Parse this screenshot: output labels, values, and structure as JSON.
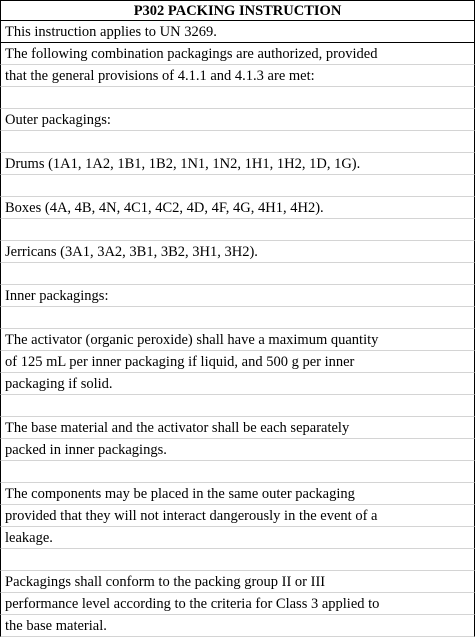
{
  "title": "P302 PACKING INSTRUCTION",
  "rows": [
    "This instruction applies to UN 3269.",
    "The following combination packagings are authorized, provided",
    "that the general provisions of 4.1.1 and 4.1.3 are met:",
    "",
    "Outer packagings:",
    "",
    "Drums (1A1, 1A2, 1B1, 1B2, 1N1, 1N2, 1H1, 1H2, 1D, 1G).",
    "",
    "Boxes (4A, 4B, 4N, 4C1, 4C2, 4D, 4F, 4G, 4H1, 4H2).",
    "",
    "Jerricans (3A1, 3A2, 3B1, 3B2, 3H1, 3H2).",
    "",
    "Inner packagings:",
    "",
    "The activator (organic peroxide) shall have a maximum quantity",
    "of 125 mL per inner packaging if liquid, and 500 g per inner",
    "packaging if solid.",
    "",
    "The base material and the activator shall be each separately",
    "packed in inner packagings.",
    "",
    "The components may be placed in the same outer packaging",
    "provided that they will not interact dangerously in the event of a",
    "leakage.",
    "",
    "Packagings shall conform to the packing group II or III",
    "performance level according to the criteria for Class 3 applied to",
    "the base material."
  ]
}
